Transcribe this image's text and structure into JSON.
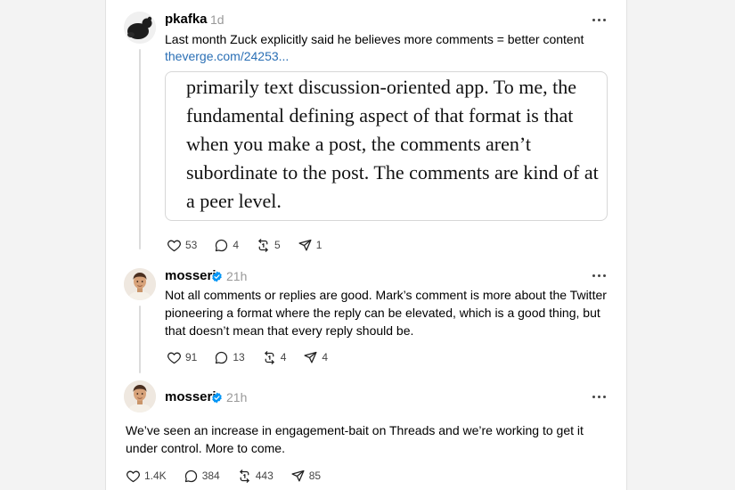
{
  "posts": [
    {
      "username": "pkafka",
      "time": "1d",
      "verified": false,
      "text": "Last month Zuck explicitly said he believes more comments = better content",
      "link": "theverge.com/24253...",
      "quote": "primarily text discussion-oriented app. To me, the fundamental defining aspect of that format is that when you make a post, the comments aren’t subordinate to the post. The comments are kind of at a peer level.",
      "stats": {
        "likes": "53",
        "replies": "4",
        "reposts": "5",
        "shares": "1"
      }
    },
    {
      "username": "mosseri",
      "time": "21h",
      "verified": true,
      "text": "Not all comments or replies are good. Mark’s comment is more about the Twitter pioneering a format where the reply can be elevated, which is a good thing, but that doesn’t mean that every reply should be.",
      "stats": {
        "likes": "91",
        "replies": "13",
        "reposts": "4",
        "shares": "4"
      }
    },
    {
      "username": "mosseri",
      "time": "21h",
      "verified": true,
      "text": "We’ve seen an increase in engagement-bait on Threads and we’re working to get it under control. More to come.",
      "stats": {
        "likes": "1.4K",
        "replies": "384",
        "reposts": "443",
        "shares": "85"
      }
    }
  ],
  "colors": {
    "link": "#2a6fb5",
    "verified": "#0095f6",
    "muted": "#999999"
  },
  "icons": [
    "heart-icon",
    "comment-icon",
    "repost-icon",
    "share-icon",
    "more-icon",
    "verified-icon"
  ]
}
